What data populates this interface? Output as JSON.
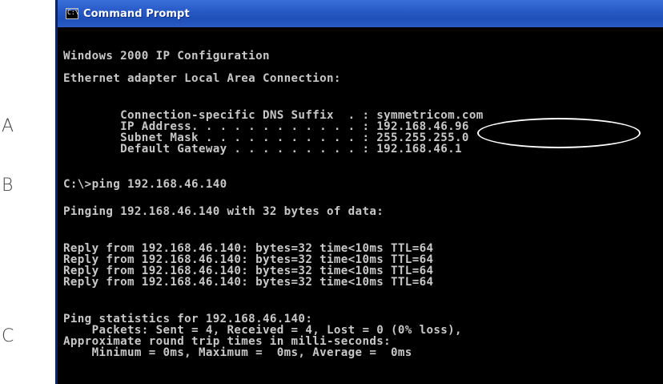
{
  "labels": {
    "a": "A",
    "b": "B",
    "c": "C"
  },
  "window": {
    "title": "Command Prompt",
    "icon": "console-window-icon",
    "icon_glyph": "C:\\"
  },
  "console": {
    "lines": [
      "Windows 2000 IP Configuration",
      "Ethernet adapter Local Area Connection:",
      "        Connection-specific DNS Suffix  . : symmetricom.com",
      "        IP Address. . . . . . . . . . . . : 192.168.46.96",
      "        Subnet Mask . . . . . . . . . . . : 255.255.255.0",
      "        Default Gateway . . . . . . . . . : 192.168.46.1",
      "C:\\>ping 192.168.46.140",
      "Pinging 192.168.46.140 with 32 bytes of data:",
      "Reply from 192.168.46.140: bytes=32 time<10ms TTL=64",
      "Reply from 192.168.46.140: bytes=32 time<10ms TTL=64",
      "Reply from 192.168.46.140: bytes=32 time<10ms TTL=64",
      "Reply from 192.168.46.140: bytes=32 time<10ms TTL=64",
      "Ping statistics for 192.168.46.140:",
      "    Packets: Sent = 4, Received = 4, Lost = 0 (0% loss),",
      "Approximate round trip times in milli-seconds:",
      "    Minimum = 0ms, Maximum =  0ms, Average =  0ms"
    ]
  },
  "colors": {
    "console_background": "#000000",
    "console_text": "#c8c8c8",
    "titlebar": "#2c5fcc",
    "highlight_ellipse": "#ffffff"
  }
}
